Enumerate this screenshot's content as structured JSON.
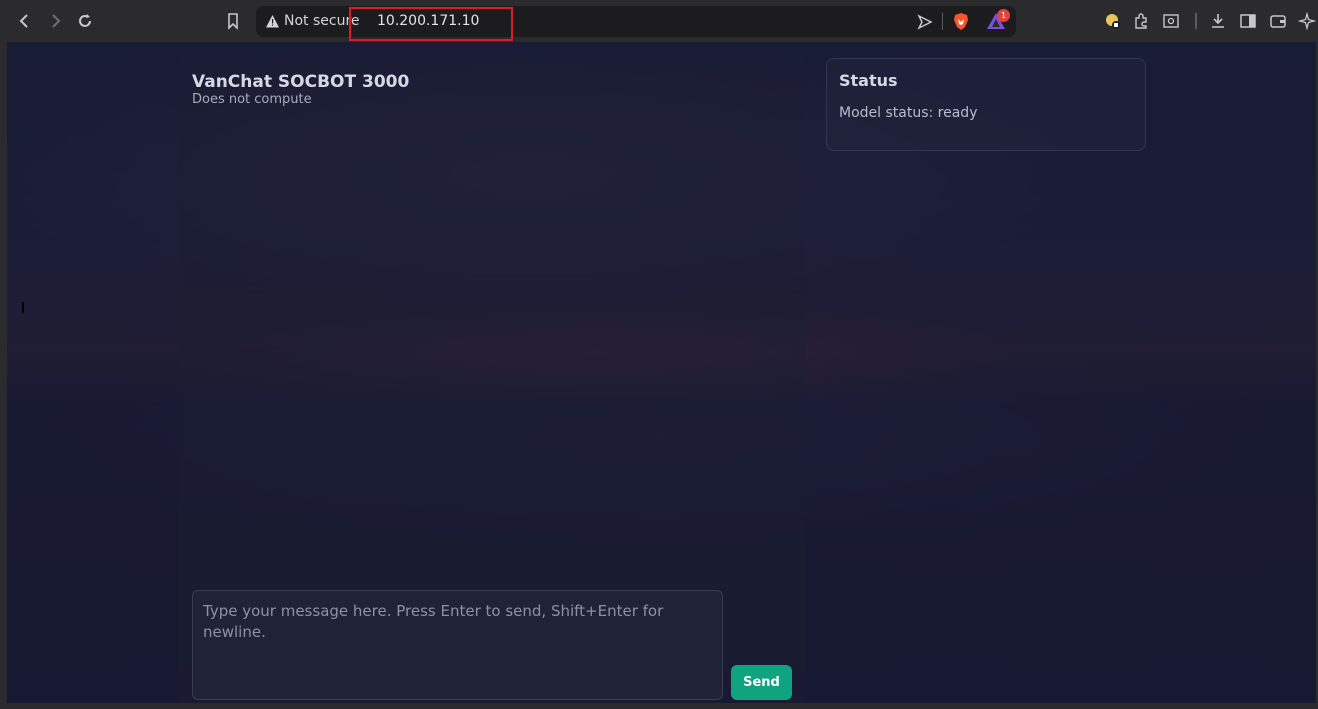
{
  "browser": {
    "security_label": "Not secure",
    "url": "10.200.171.10",
    "rewards_badge": "1",
    "icons": [
      "back-icon",
      "forward-icon",
      "reload-icon",
      "bookmark-icon",
      "warning-icon",
      "share-icon",
      "brave-shield-icon",
      "brave-rewards-icon",
      "profile-icon",
      "extensions-icon",
      "reader-icon",
      "download-icon",
      "sidebar-icon",
      "wallet-icon",
      "ai-icon"
    ]
  },
  "app": {
    "title": "VanChat SOCBOT 3000",
    "subtitle": "Does not compute",
    "input_placeholder": "Type your message here. Press Enter to send, Shift+Enter for newline.",
    "send_label": "Send"
  },
  "status": {
    "title": "Status",
    "text": "Model status: ready"
  },
  "colors": {
    "accent": "#10a37f",
    "annotation": "#e01a22"
  }
}
